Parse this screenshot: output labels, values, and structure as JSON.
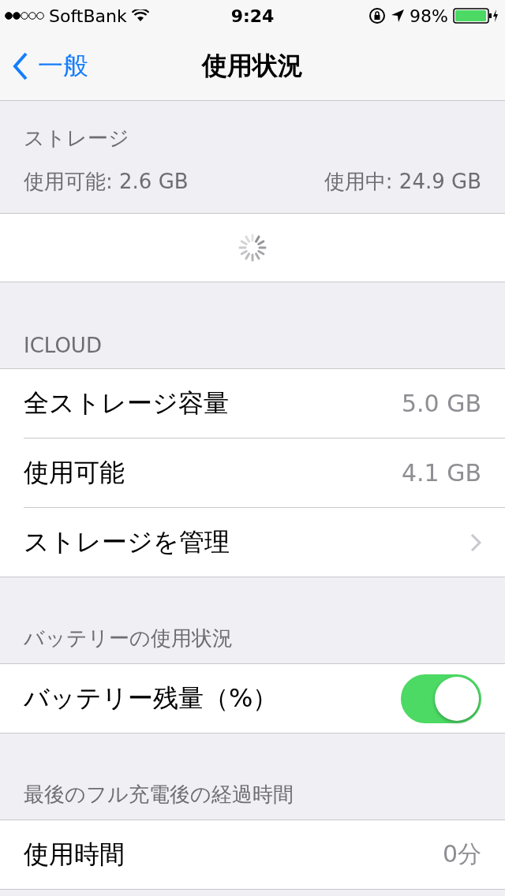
{
  "status_bar": {
    "carrier": "SoftBank",
    "time": "9:24",
    "battery": "98%"
  },
  "nav": {
    "back": "一般",
    "title": "使用状況"
  },
  "storage": {
    "header": "ストレージ",
    "available": "使用可能: 2.6 GB",
    "used": "使用中: 24.9 GB"
  },
  "sections": [
    {
      "header": "ICLOUD",
      "rows": [
        {
          "kind": "value",
          "label": "全ストレージ容量",
          "value": "5.0 GB"
        },
        {
          "kind": "value",
          "label": "使用可能",
          "value": "4.1 GB"
        },
        {
          "kind": "disclosure",
          "label": "ストレージを管理"
        }
      ]
    },
    {
      "header": "バッテリーの使用状況",
      "rows": [
        {
          "kind": "toggle",
          "label": "バッテリー残量（%）",
          "on": true
        }
      ]
    },
    {
      "header": "最後のフル充電後の経過時間",
      "rows": [
        {
          "kind": "value",
          "label": "使用時間",
          "value": "0分"
        }
      ]
    }
  ]
}
